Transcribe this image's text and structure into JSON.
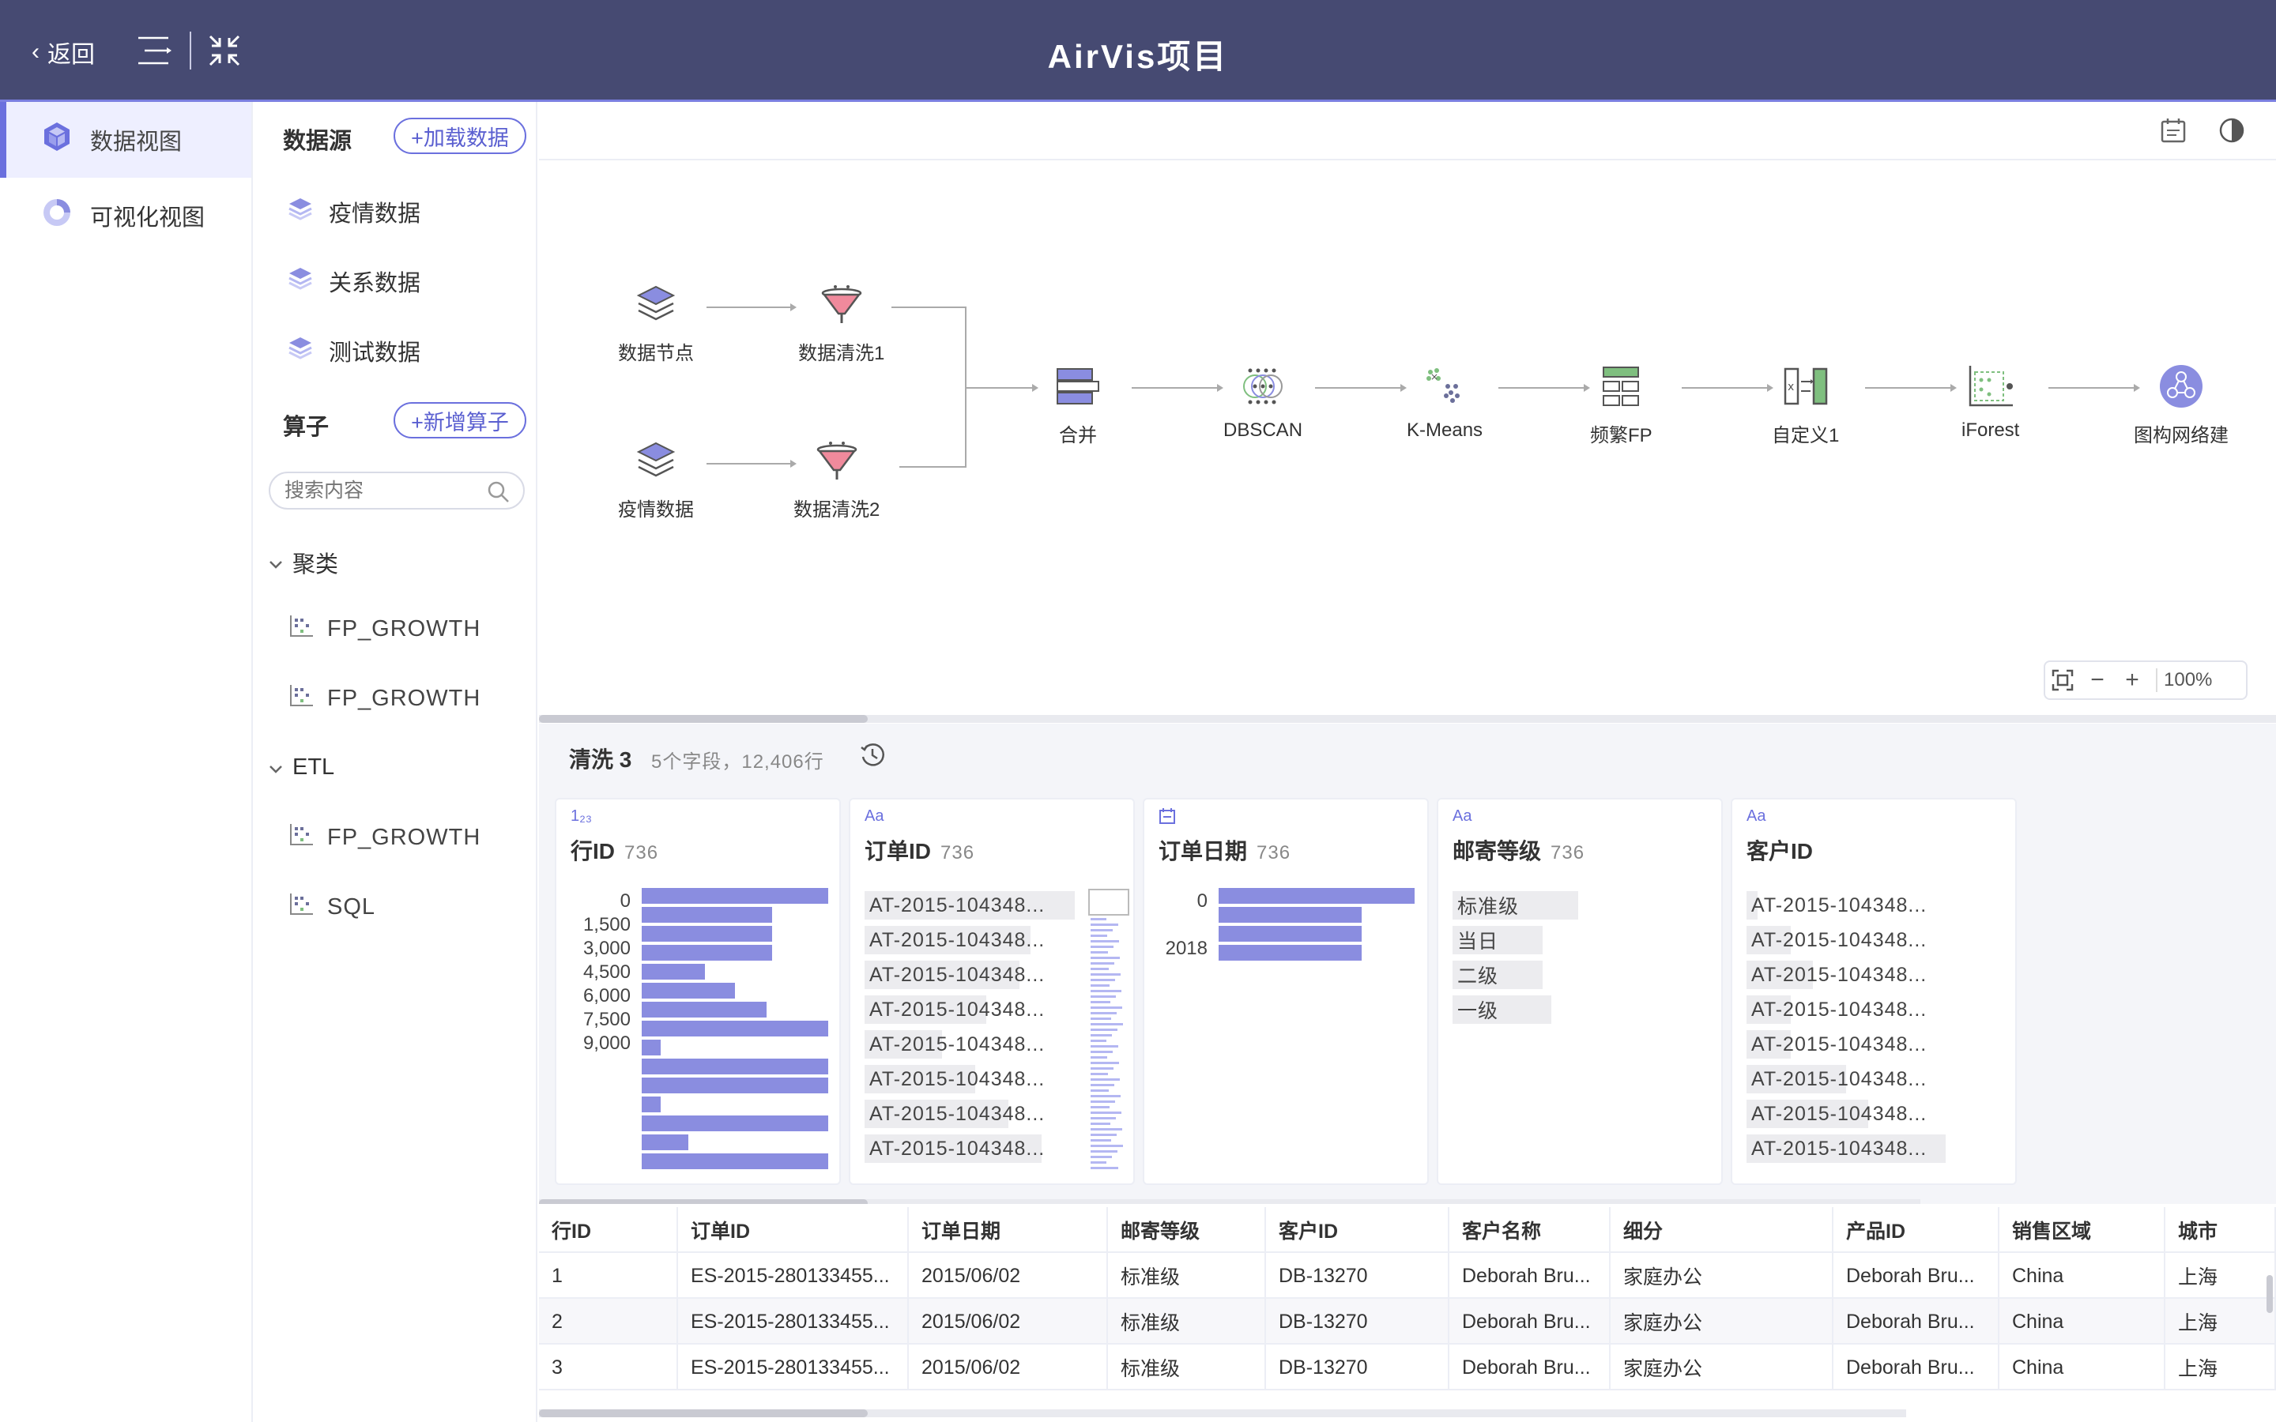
{
  "header": {
    "back_label": "返回",
    "title": "AirVis项目"
  },
  "nav": {
    "items": [
      {
        "label": "数据视图"
      },
      {
        "label": "可视化视图"
      }
    ]
  },
  "panel": {
    "sources_title": "数据源",
    "add_data_label": "+加载数据",
    "sources": [
      "疫情数据",
      "关系数据",
      "测试数据"
    ],
    "operators_title": "算子",
    "add_operator_label": "+新增算子",
    "search_placeholder": "搜索内容",
    "groups": [
      {
        "name": "聚类",
        "items": [
          "FP_GROWTH",
          "FP_GROWTH"
        ]
      },
      {
        "name": "ETL",
        "items": [
          "FP_GROWTH",
          "SQL"
        ]
      }
    ]
  },
  "flow": {
    "nodes": [
      "数据节点",
      "数据清洗1",
      "疫情数据",
      "数据清洗2",
      "合并",
      "DBSCAN",
      "K-Means",
      "频繁FP",
      "自定义1",
      "iForest",
      "图构网络建"
    ],
    "zoom": "100%"
  },
  "preview": {
    "title": "清洗 3",
    "subtitle": "5个字段，12,406行",
    "cards": [
      {
        "type_icon": "1₂₃",
        "name": "行ID",
        "count": "736",
        "ticks": [
          "0",
          "1,500",
          "3,000",
          "4,500",
          "6,000",
          "7,500",
          "9,000"
        ],
        "bar_fraction": [
          1.0,
          0.7,
          0.7,
          0.7,
          0.34,
          0.5,
          0.67,
          1.0,
          0.1,
          1.0,
          1.0,
          0.1,
          1.0,
          0.25,
          1.0
        ]
      },
      {
        "type_icon": "Aa",
        "name": "订单ID",
        "count": "736",
        "values": [
          "AT-2015-104348...",
          "AT-2015-104348...",
          "AT-2015-104348...",
          "AT-2015-104348...",
          "AT-2015-104348...",
          "AT-2015-104348...",
          "AT-2015-104348...",
          "AT-2015-104348..."
        ],
        "fill_fraction": [
          0.95,
          0.75,
          0.7,
          0.55,
          0.35,
          0.5,
          0.65,
          0.8
        ]
      },
      {
        "type_icon": "calendar",
        "name": "订单日期",
        "count": "736",
        "ticks": [
          "0",
          "2018"
        ],
        "bar_fraction": [
          1.0,
          0.73,
          0.73,
          0.73
        ]
      },
      {
        "type_icon": "Aa",
        "name": "邮寄等级",
        "count": "736",
        "values": [
          "标准级",
          "当日",
          "二级",
          "一级"
        ],
        "fill_fraction": [
          0.71,
          0.51,
          0.51,
          0.56
        ]
      },
      {
        "type_icon": "Aa",
        "name": "客户ID",
        "count": "",
        "values": [
          "AT-2015-104348...",
          "AT-2015-104348...",
          "AT-2015-104348...",
          "AT-2015-104348...",
          "AT-2015-104348...",
          "AT-2015-104348...",
          "AT-2015-104348...",
          "AT-2015-104348..."
        ],
        "fill_fraction": [
          0.05,
          0.2,
          0.3,
          0.2,
          0.2,
          0.45,
          0.55,
          0.9
        ]
      }
    ]
  },
  "table": {
    "columns": [
      "行ID",
      "订单ID",
      "订单日期",
      "邮寄等级",
      "客户ID",
      "客户名称",
      "细分",
      "产品ID",
      "销售区域",
      "城市"
    ],
    "rows": [
      [
        "1",
        "ES-2015-280133455...",
        "2015/06/02",
        "标准级",
        "DB-13270",
        "Deborah Bru...",
        "家庭办公",
        "Deborah Bru...",
        "China",
        "上海"
      ],
      [
        "2",
        "ES-2015-280133455...",
        "2015/06/02",
        "标准级",
        "DB-13270",
        "Deborah Bru...",
        "家庭办公",
        "Deborah Bru...",
        "China",
        "上海"
      ],
      [
        "3",
        "ES-2015-280133455...",
        "2015/06/02",
        "标准级",
        "DB-13270",
        "Deborah Bru...",
        "家庭办公",
        "Deborah Bru...",
        "China",
        "上海"
      ]
    ]
  },
  "colors": {
    "header_bg": "#464a72",
    "accent": "#6b70de",
    "bar": "#8a8de0"
  }
}
